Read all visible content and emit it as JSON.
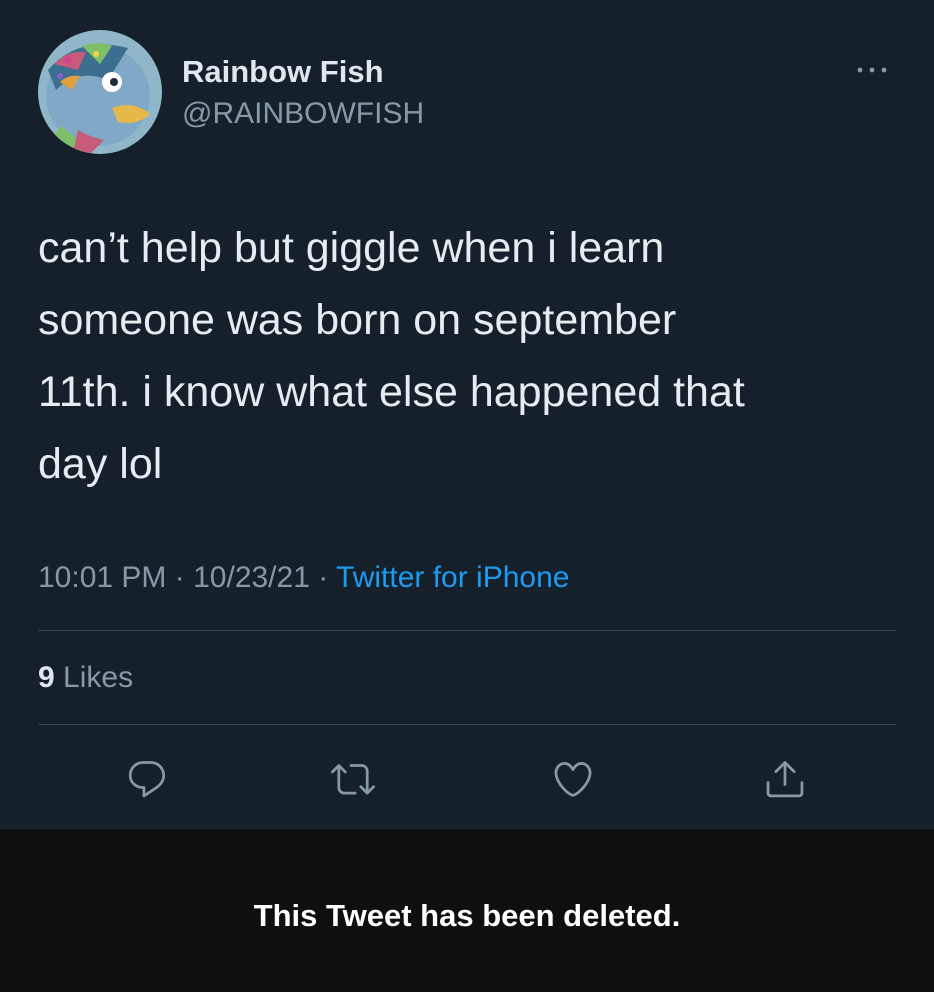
{
  "user": {
    "display_name": "Rainbow Fish",
    "handle": "@RAINBOWFISH",
    "avatar_icon": "rainbow-fish-avatar"
  },
  "tweet": {
    "text": "can’t help but giggle when i learn\nsomeone was born on september\n11th. i know what else happened that\nday lol",
    "time": "10:01 PM",
    "date": "10/23/21",
    "separator": "·",
    "source": "Twitter for iPhone",
    "likes_count": "9",
    "likes_label": "Likes"
  },
  "actions": {
    "reply_icon": "reply-icon",
    "retweet_icon": "retweet-icon",
    "like_icon": "heart-icon",
    "share_icon": "share-icon"
  },
  "banner": {
    "deleted_text": "This Tweet has been deleted."
  },
  "colors": {
    "background": "#15202b",
    "accent": "#1d9bf0",
    "secondary_text": "#8899a6",
    "primary_text": "#e1e8ed",
    "bottom_bar": "#0f0f10"
  }
}
